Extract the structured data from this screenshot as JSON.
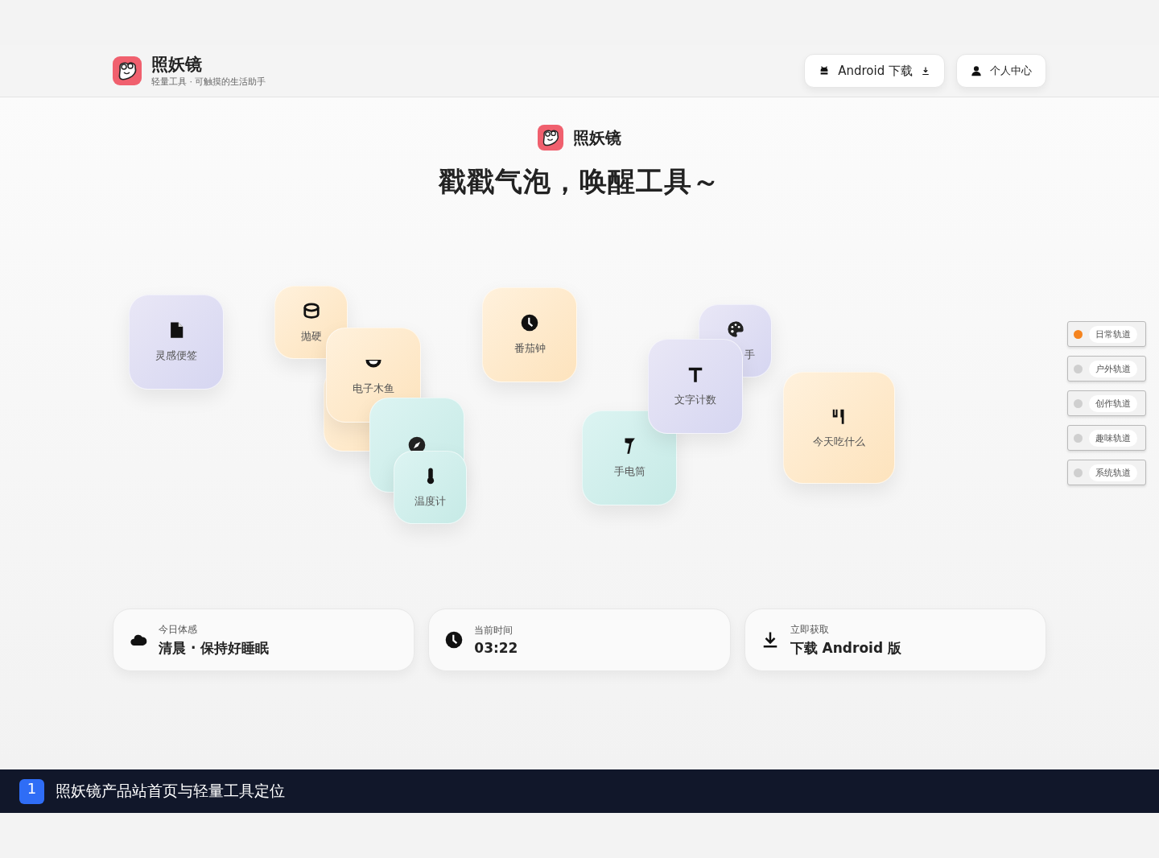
{
  "header": {
    "title": "照妖镜",
    "subtitle": "轻量工具 · 可触摸的生活助手",
    "buttons": [
      "Android 下载",
      "个人中心"
    ]
  },
  "hero": {
    "brand": "照妖镜",
    "headline": "戳戳气泡，唤醒工具～"
  },
  "bubbles": [
    "灵感便签",
    "抛硬",
    "电子木鱼",
    "温度计",
    "番茄钟",
    "手",
    "手电筒",
    "文字计数",
    "今天吃什么"
  ],
  "tracks": [
    {
      "label": "日常轨道",
      "selected": true
    },
    {
      "label": "户外轨道",
      "selected": false
    },
    {
      "label": "创作轨道",
      "selected": false
    },
    {
      "label": "趣味轨道",
      "selected": false
    },
    {
      "label": "系统轨道",
      "selected": false
    }
  ],
  "cards": [
    {
      "label": "今日体感",
      "value": "清晨 · 保持好睡眠"
    },
    {
      "label": "当前时间",
      "value": "03:22"
    },
    {
      "label": "立即获取",
      "value": "下载 Android 版"
    }
  ],
  "caption": {
    "number": "1",
    "text": "照妖镜产品站首页与轻量工具定位"
  }
}
